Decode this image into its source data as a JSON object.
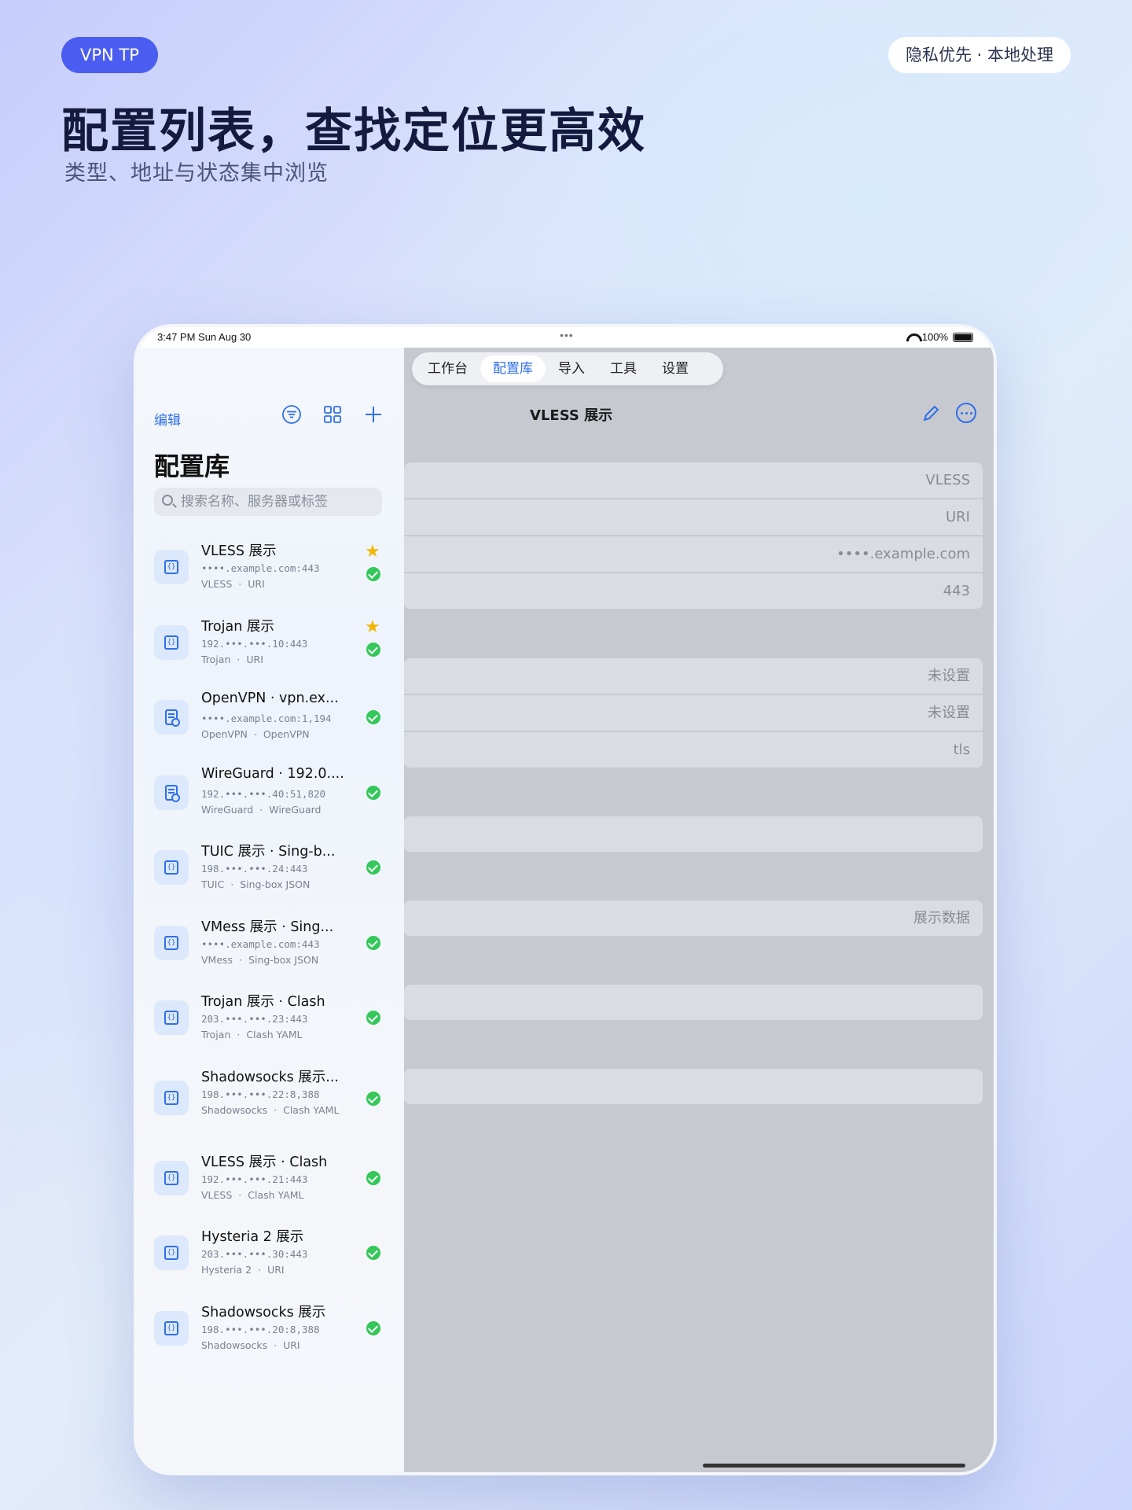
{
  "header": {
    "brand": "VPN TP",
    "privacy_badge": "隐私优先 ·  本地处理",
    "headline": "配置列表，查找定位更高效",
    "subline": "类型、地址与状态集中浏览"
  },
  "status_bar": {
    "time": "3:47 PM   Sun Aug 30",
    "dots": "•••",
    "battery": "100%"
  },
  "tabs": [
    {
      "label": "工作台"
    },
    {
      "label": "配置库",
      "active": true
    },
    {
      "label": "导入"
    },
    {
      "label": "工具"
    },
    {
      "label": "设置"
    }
  ],
  "sidebar": {
    "edit_label": "编辑",
    "title": "配置库",
    "search_placeholder": "搜索名称、服务器或标签",
    "items": [
      {
        "name": "VLESS 展示",
        "address": "••••.example.com:443",
        "protocol": "VLESS",
        "format": "URI",
        "starred": true,
        "icon": "code-file-icon"
      },
      {
        "name": "Trojan 展示",
        "address": "192.•••.•••.10:443",
        "protocol": "Trojan",
        "format": "URI",
        "starred": true,
        "icon": "code-file-icon"
      },
      {
        "name": "OpenVPN · vpn.ex...",
        "address": "••••.example.com:1,194",
        "protocol": "OpenVPN",
        "format": "OpenVPN",
        "starred": false,
        "icon": "document-search-icon"
      },
      {
        "name": "WireGuard · 192.0....",
        "address": "192.•••.•••.40:51,820",
        "protocol": "WireGuard",
        "format": "WireGuard",
        "starred": false,
        "icon": "document-search-icon"
      },
      {
        "name": "TUIC 展示 · Sing-b...",
        "address": "198.•••.•••.24:443",
        "protocol": "TUIC",
        "format": "Sing-box JSON",
        "starred": false,
        "icon": "code-file-icon"
      },
      {
        "name": "VMess 展示 · Sing...",
        "address": "••••.example.com:443",
        "protocol": "VMess",
        "format": "Sing-box JSON",
        "starred": false,
        "icon": "code-file-icon"
      },
      {
        "name": "Trojan 展示 · Clash",
        "address": "203.•••.•••.23:443",
        "protocol": "Trojan",
        "format": "Clash YAML",
        "starred": false,
        "icon": "code-file-icon"
      },
      {
        "name": "Shadowsocks 展示...",
        "address": "198.•••.•••.22:8,388",
        "protocol": "Shadowsocks",
        "format": "Clash YAML",
        "starred": false,
        "icon": "code-file-icon"
      },
      {
        "name": "VLESS 展示 · Clash",
        "address": "192.•••.•••.21:443",
        "protocol": "VLESS",
        "format": "Clash YAML",
        "starred": false,
        "icon": "code-file-icon"
      },
      {
        "name": "Hysteria 2 展示",
        "address": "203.•••.•••.30:443",
        "protocol": "Hysteria 2",
        "format": "URI",
        "starred": false,
        "icon": "code-file-icon"
      },
      {
        "name": "Shadowsocks 展示",
        "address": "198.•••.•••.20:8,388",
        "protocol": "Shadowsocks",
        "format": "URI",
        "starred": false,
        "icon": "code-file-icon"
      }
    ]
  },
  "detail": {
    "title": "VLESS 展示",
    "rows": [
      {
        "value": "VLESS"
      },
      {
        "value": "URI"
      },
      {
        "value": "••••.example.com"
      },
      {
        "value": "443"
      },
      {
        "value": "未设置"
      },
      {
        "value": "未设置"
      },
      {
        "value": "tls"
      },
      {
        "value": ""
      },
      {
        "value": "展示数据"
      },
      {
        "value": ""
      },
      {
        "value": ""
      }
    ]
  },
  "colors": {
    "accent": "#2f6fe8",
    "brand_pill": "#4b5df0",
    "star": "#f2b705",
    "status_ok": "#34c759"
  }
}
